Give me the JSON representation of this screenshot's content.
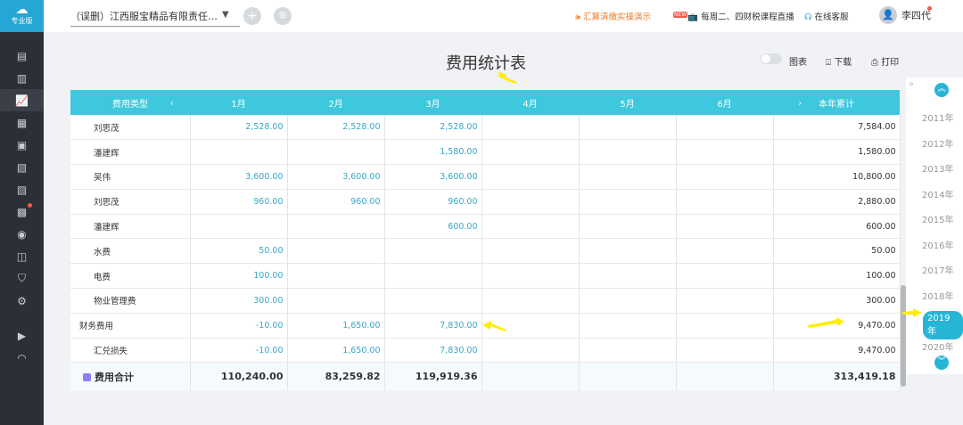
{
  "app": {
    "edition_label": "专业版"
  },
  "topbar": {
    "company_name": "（误删）江西服宝精品有限责任…",
    "demo_link": "汇算清缴实操演示",
    "live_badge": "NEW",
    "live_link": "每周二、四财税课程直播",
    "service_link": "在线客服",
    "user_name": "李四代"
  },
  "page": {
    "title": "费用统计表",
    "chart_toggle_label": "图表",
    "download_label": "下载",
    "print_label": "打印"
  },
  "table": {
    "headers": [
      "费用类型",
      "1月",
      "2月",
      "3月",
      "4月",
      "5月",
      "6月",
      "本年累计"
    ],
    "rows": [
      {
        "name": "刘思茂",
        "level": 1,
        "m1": "2,528.00",
        "m2": "2,528.00",
        "m3": "2,528.00",
        "m4": "",
        "m5": "",
        "m6": "",
        "total": "7,584.00"
      },
      {
        "name": "潘建辉",
        "level": 1,
        "m1": "",
        "m2": "",
        "m3": "1,580.00",
        "m4": "",
        "m5": "",
        "m6": "",
        "total": "1,580.00"
      },
      {
        "name": "吴伟",
        "level": 1,
        "m1": "3,600.00",
        "m2": "3,600.00",
        "m3": "3,600.00",
        "m4": "",
        "m5": "",
        "m6": "",
        "total": "10,800.00"
      },
      {
        "name": "刘思茂",
        "level": 1,
        "m1": "960.00",
        "m2": "960.00",
        "m3": "960.00",
        "m4": "",
        "m5": "",
        "m6": "",
        "total": "2,880.00"
      },
      {
        "name": "潘建辉",
        "level": 1,
        "m1": "",
        "m2": "",
        "m3": "600.00",
        "m4": "",
        "m5": "",
        "m6": "",
        "total": "600.00"
      },
      {
        "name": "水费",
        "level": 1,
        "m1": "50.00",
        "m2": "",
        "m3": "",
        "m4": "",
        "m5": "",
        "m6": "",
        "total": "50.00"
      },
      {
        "name": "电费",
        "level": 1,
        "m1": "100.00",
        "m2": "",
        "m3": "",
        "m4": "",
        "m5": "",
        "m6": "",
        "total": "100.00"
      },
      {
        "name": "物业管理费",
        "level": 1,
        "m1": "300.00",
        "m2": "",
        "m3": "",
        "m4": "",
        "m5": "",
        "m6": "",
        "total": "300.00"
      },
      {
        "name": "财务费用",
        "level": 0,
        "m1": "-10.00",
        "m2": "1,650.00",
        "m3": "7,830.00",
        "m4": "",
        "m5": "",
        "m6": "",
        "total": "9,470.00"
      },
      {
        "name": "汇兑损失",
        "level": 1,
        "m1": "-10.00",
        "m2": "1,650.00",
        "m3": "7,830.00",
        "m4": "",
        "m5": "",
        "m6": "",
        "total": "9,470.00"
      }
    ],
    "sum_row": {
      "name": "费用合计",
      "m1": "110,240.00",
      "m2": "83,259.82",
      "m3": "119,919.36",
      "m4": "",
      "m5": "",
      "m6": "",
      "total": "313,419.18"
    }
  },
  "years": [
    "2011年",
    "2012年",
    "2013年",
    "2014年",
    "2015年",
    "2016年",
    "2017年",
    "2018年",
    "2019年",
    "2020年"
  ],
  "selected_year": "2019年",
  "colors": {
    "accent": "#3ec8dd",
    "sidebar": "#2b2f36",
    "annotation_arrow": "#ffee00",
    "link_orange": "#f07b2a"
  }
}
